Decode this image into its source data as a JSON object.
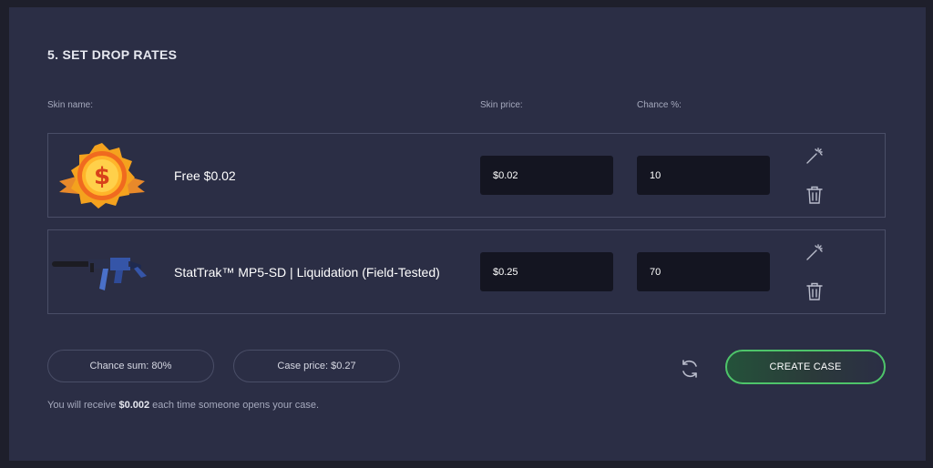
{
  "section": {
    "title": "5. SET DROP RATES"
  },
  "columns": {
    "skin_name": "Skin name:",
    "skin_price": "Skin price:",
    "chance": "Chance %:"
  },
  "skins": [
    {
      "name": "Free $0.02",
      "price": "$0.02",
      "chance": "10",
      "image_icon": "gold-dollar-badge-icon"
    },
    {
      "name": "StatTrak™ MP5-SD | Liquidation (Field-Tested)",
      "price": "$0.25",
      "chance": "70",
      "image_icon": "mp5-sd-weapon-icon"
    }
  ],
  "actions": {
    "edit_icon": "magic-wand-icon",
    "delete_icon": "trash-icon",
    "refresh_icon": "refresh-icon"
  },
  "summary": {
    "chance_sum": "Chance sum: 80%",
    "case_price": "Case price: $0.27",
    "create_label": "CREATE CASE"
  },
  "note": {
    "prefix": "You will receive ",
    "amount": "$0.002",
    "suffix": " each time someone opens your case."
  },
  "colors": {
    "background": "#2b2e45",
    "field": "#141521",
    "border": "#4a4e67",
    "accent": "#4ec46a"
  }
}
